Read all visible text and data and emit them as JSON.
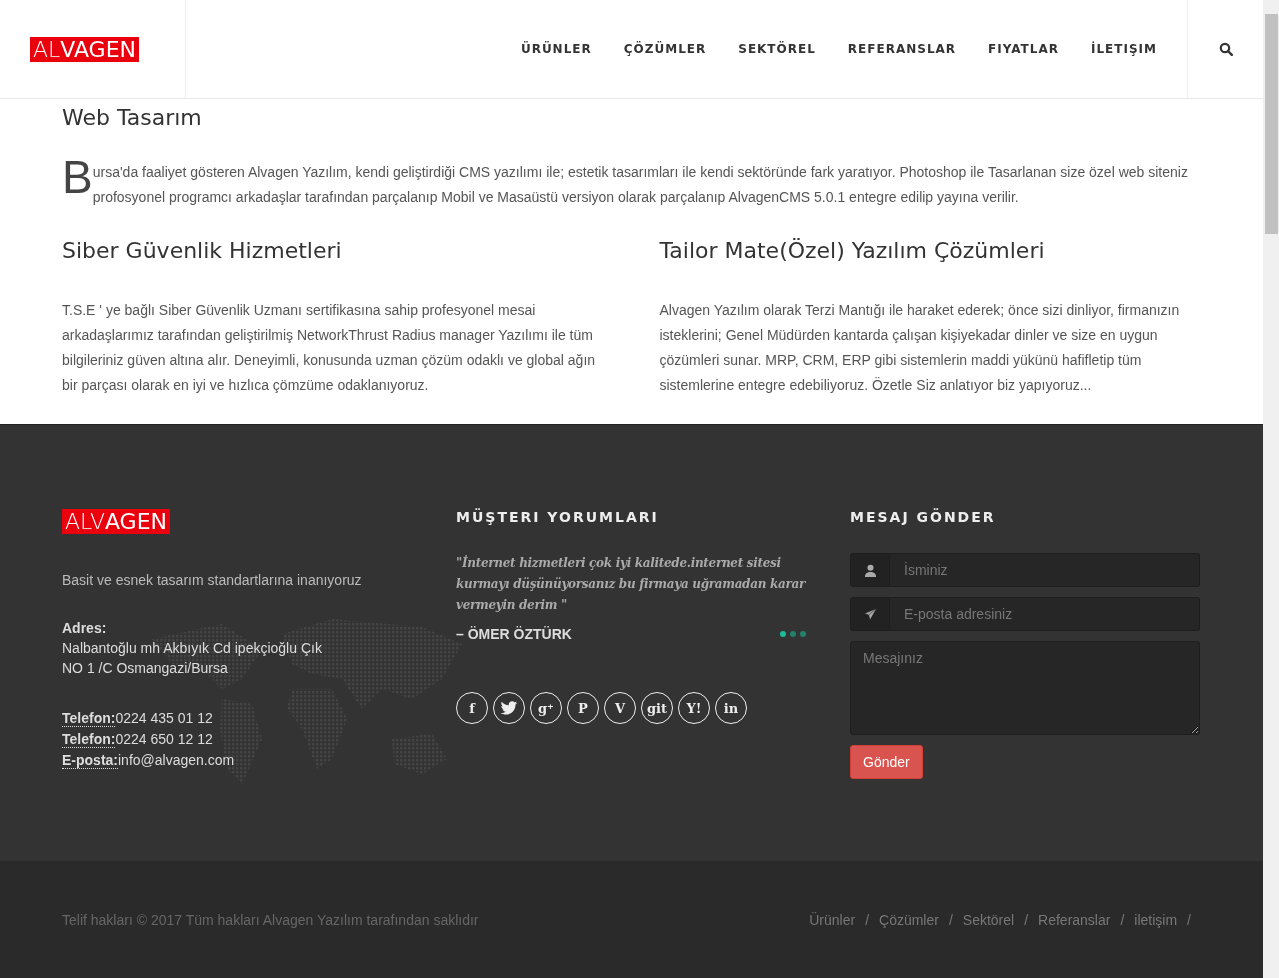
{
  "header": {
    "logo": "AL**VAGEN**",
    "nav": [
      {
        "label": "ÜRÜNLER",
        "selected": false
      },
      {
        "label": "ÇÖZÜMLER",
        "selected": false
      },
      {
        "label": "SEKTÖREL",
        "selected": false
      },
      {
        "label": "REFERANSLAR",
        "selected": false
      },
      {
        "label": "FIYATLAR",
        "selected": false
      },
      {
        "label": "İLETIŞIM",
        "selected": false
      }
    ]
  },
  "intro": {
    "title": "Web Tasarım",
    "dropcap": "B",
    "text": "ursa'da faaliyet gösteren Alvagen Yazılım, kendi geliştirdiği CMS yazılımı ile; estetik tasarımları ile kendi sektöründe fark yaratıyor. Photoshop ile Tasarlanan size özel web siteniz profosyonel programcı arkadaşlar tarafından parçalanıp Mobil ve Masaüstü versiyon olarak parçalanıp AlvagenCMS 5.0.1 entegre edilip yayına verilir."
  },
  "features": [
    {
      "title": "Siber Güvenlik Hizmetleri",
      "text": "T.S.E ' ye bağlı Siber Güvenlik Uzmanı sertifikasına sahip profesyonel mesai arkadaşlarımız tarafından geliştirilmiş NetworkThrust Radius manager Yazılımı ile tüm bilgileriniz güven altına alır. Deneyimli, konusunda uzman çözüm odaklı ve global ağın bir parçası olarak en iyi ve hızlıca çömzüme odaklanıyoruz."
    },
    {
      "title": "Tailor Mate(Özel) Yazılım Çözümleri",
      "text": "Alvagen Yazılım olarak Terzi Mantığı ile haraket ederek; önce sizi dinliyor, firmanızın isteklerini; Genel Müdürden kantarda çalışan kişiyekadar dinler ve size en uygun çözümleri sunar. MRP, CRM, ERP gibi sistemlerin maddi yükünü hafifletip tüm sistemlerine entegre edebiliyoruz. Özetle Siz anlatıyor biz yapıyoruz..."
    }
  ],
  "footer": {
    "logo": "ALV**AGEN**",
    "tagline": "Basit ve esnek tasarım standartlarına inanıyoruz",
    "address_label": "Adres:",
    "address": [
      "Nalbantoğlu mh Akbıyık Cd ipekçioğlu Çık",
      "NO 1 /C Osmangazi/Bursa"
    ],
    "contacts": [
      {
        "label": "Telefon:",
        "value": "0224 435 01 12"
      },
      {
        "label": "Telefon:",
        "value": "0224 650 12 12"
      },
      {
        "label": "E-posta:",
        "value": "info@alvagen.com"
      }
    ],
    "testimonials": {
      "heading": "MÜŞTERI YORUMLARI",
      "quote": "\"İnternet hizmetleri çok iyi kalitede.internet sitesi kurmayı düşünüyorsanız bu firmaya uğramadan karar vermeyin derim \"",
      "author": "– ÖMER ÖZTÜRK",
      "dots": [
        {
          "selected": true
        },
        {
          "selected": false
        },
        {
          "selected": false
        }
      ]
    },
    "social": [
      {
        "kind": "glyph",
        "glyph": "f"
      },
      {
        "kind": "bird"
      },
      {
        "kind": "glyph",
        "glyph": "g⁺"
      },
      {
        "kind": "glyph",
        "glyph": "P"
      },
      {
        "kind": "glyph",
        "glyph": "V"
      },
      {
        "kind": "glyph",
        "glyph": "git"
      },
      {
        "kind": "glyph",
        "glyph": "Y!"
      },
      {
        "kind": "glyph",
        "glyph": "in"
      }
    ],
    "form": {
      "heading": "MESAJ GÖNDER",
      "name_placeholder": "İsminiz",
      "email_placeholder": "E-posta adresiniz",
      "message_placeholder": "Mesajınız",
      "submit": "Gönder"
    }
  },
  "bottom": {
    "copyright": "Telif hakları © 2017 Tüm hakları Alvagen Yazılım tarafından saklıdır",
    "separator": "/",
    "links": [
      "Ürünler",
      "Çözümler",
      "Sektörel",
      "Referanslar",
      "iletişim"
    ]
  }
}
